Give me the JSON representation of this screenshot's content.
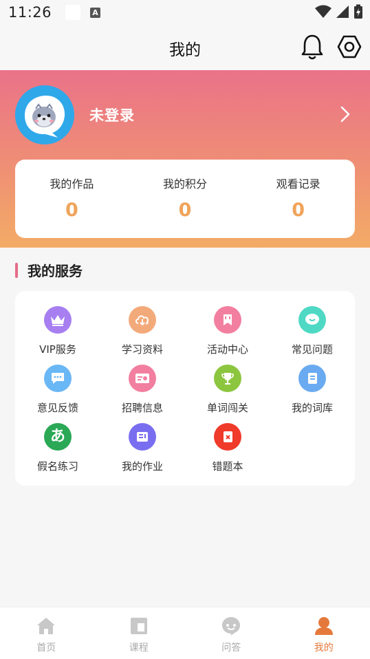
{
  "status_bar": {
    "time": "11:26",
    "a_icon_text": "A"
  },
  "header": {
    "title": "我的",
    "bell_icon": "bell-icon",
    "settings_icon": "hexagon-settings-icon"
  },
  "profile": {
    "name": "未登录",
    "avatar_icon": "seal-mascot-avatar",
    "accent": "#2fa8ea"
  },
  "stats": [
    {
      "label": "我的作品",
      "value": "0"
    },
    {
      "label": "我的积分",
      "value": "0"
    },
    {
      "label": "观看记录",
      "value": "0"
    }
  ],
  "services": {
    "title": "我的服务",
    "items": [
      {
        "label": "VIP服务",
        "icon": "crown-icon",
        "color": "#a77ff0"
      },
      {
        "label": "学习资料",
        "icon": "cloud-download-icon",
        "color": "#f3aa7a"
      },
      {
        "label": "活动中心",
        "icon": "tag-icon",
        "color": "#f27fa0"
      },
      {
        "label": "常见问题",
        "icon": "smile-bubble-icon",
        "color": "#4fd9c4"
      },
      {
        "label": "意见反馈",
        "icon": "chat-bubble-icon",
        "color": "#6ab7f5"
      },
      {
        "label": "招聘信息",
        "icon": "id-card-icon",
        "color": "#f27fa0"
      },
      {
        "label": "单词闯关",
        "icon": "trophy-icon",
        "color": "#8cc63f"
      },
      {
        "label": "我的词库",
        "icon": "document-icon",
        "color": "#6aaaf0"
      },
      {
        "label": "假名练习",
        "icon": "hiragana-a-icon",
        "glyph": "あ",
        "color": "#2aa855"
      },
      {
        "label": "我的作业",
        "icon": "homework-icon",
        "color": "#7a6ef0"
      },
      {
        "label": "错题本",
        "icon": "error-book-icon",
        "color": "#f03a2a"
      }
    ]
  },
  "nav": [
    {
      "label": "首页",
      "icon": "home-icon",
      "active": false
    },
    {
      "label": "课程",
      "icon": "course-icon",
      "active": false
    },
    {
      "label": "问答",
      "icon": "qa-icon",
      "active": false
    },
    {
      "label": "我的",
      "icon": "profile-icon",
      "active": true
    }
  ],
  "colors": {
    "active_nav": "#e5793c",
    "stat_value": "#f0a45a",
    "inactive_nav": "#c8c8c8"
  }
}
